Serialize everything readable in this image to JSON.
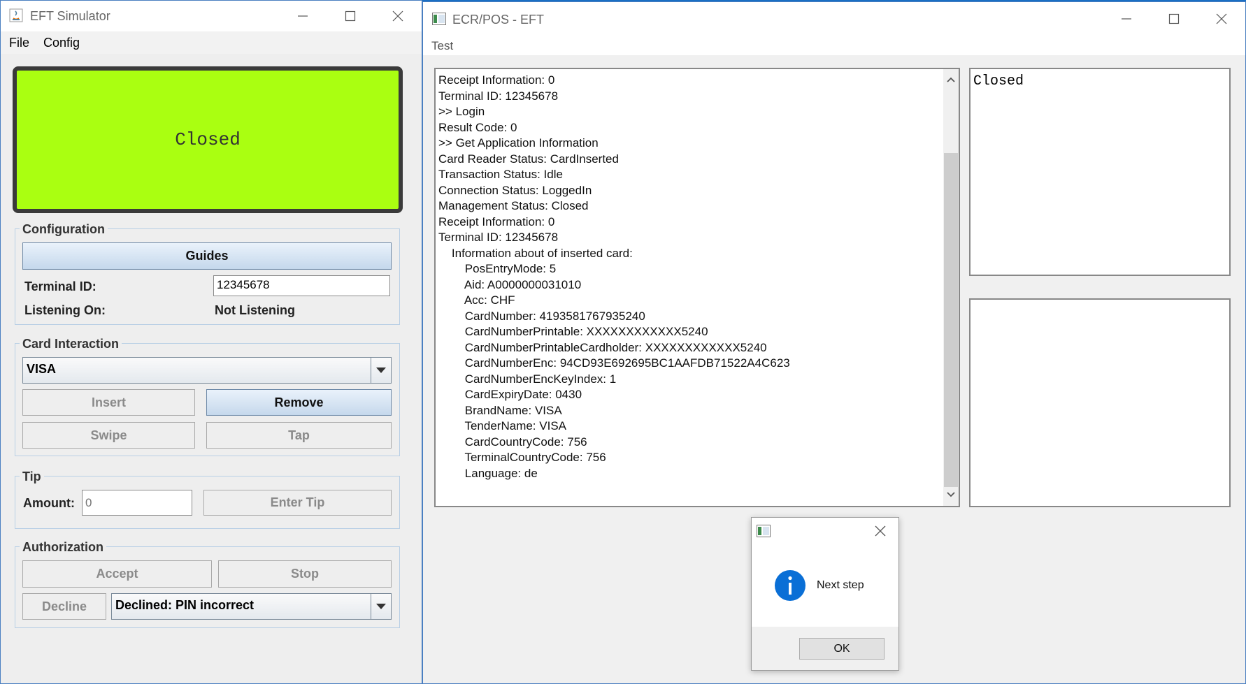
{
  "eft": {
    "title": "EFT Simulator",
    "menu": [
      "File",
      "Config"
    ],
    "display_text": "Closed",
    "display_color": "#aaff11",
    "configuration": {
      "legend": "Configuration",
      "guides_label": "Guides",
      "terminal_id_label": "Terminal ID:",
      "terminal_id_value": "12345678",
      "listening_label": "Listening On:",
      "listening_value": "Not Listening"
    },
    "card_interaction": {
      "legend": "Card Interaction",
      "selected_card": "VISA",
      "insert": "Insert",
      "remove": "Remove",
      "swipe": "Swipe",
      "tap": "Tap"
    },
    "tip": {
      "legend": "Tip",
      "amount_label": "Amount:",
      "amount_placeholder": "0",
      "enter_tip": "Enter Tip"
    },
    "authorization": {
      "legend": "Authorization",
      "accept": "Accept",
      "stop": "Stop",
      "decline": "Decline",
      "decline_reason": "Declined: PIN incorrect"
    }
  },
  "ecr": {
    "title": "ECR/POS - EFT",
    "menu": [
      "Test"
    ],
    "log_lines": [
      "Receipt Information: 0",
      "Terminal ID: 12345678",
      ">> Login",
      "Result Code: 0",
      ">> Get Application Information",
      "Card Reader Status: CardInserted",
      "Transaction Status: Idle",
      "Connection Status: LoggedIn",
      "Management Status: Closed",
      "Receipt Information: 0",
      "Terminal ID: 12345678",
      "    Information about of inserted card:",
      "        PosEntryMode: 5",
      "        Aid: A0000000031010",
      "        Acc: CHF",
      "        CardNumber: 4193581767935240",
      "        CardNumberPrintable: XXXXXXXXXXXX5240",
      "        CardNumberPrintableCardholder: XXXXXXXXXXXX5240",
      "        CardNumberEnc: 94CD93E692695BC1AAFDB71522A4C623",
      "        CardNumberEncKeyIndex: 1",
      "        CardExpiryDate: 0430",
      "        BrandName: VISA",
      "        TenderName: VISA",
      "        CardCountryCode: 756",
      "        TerminalCountryCode: 756",
      "        Language: de"
    ],
    "display_text": "Closed"
  },
  "dialog": {
    "message": "Next step",
    "ok": "OK"
  }
}
